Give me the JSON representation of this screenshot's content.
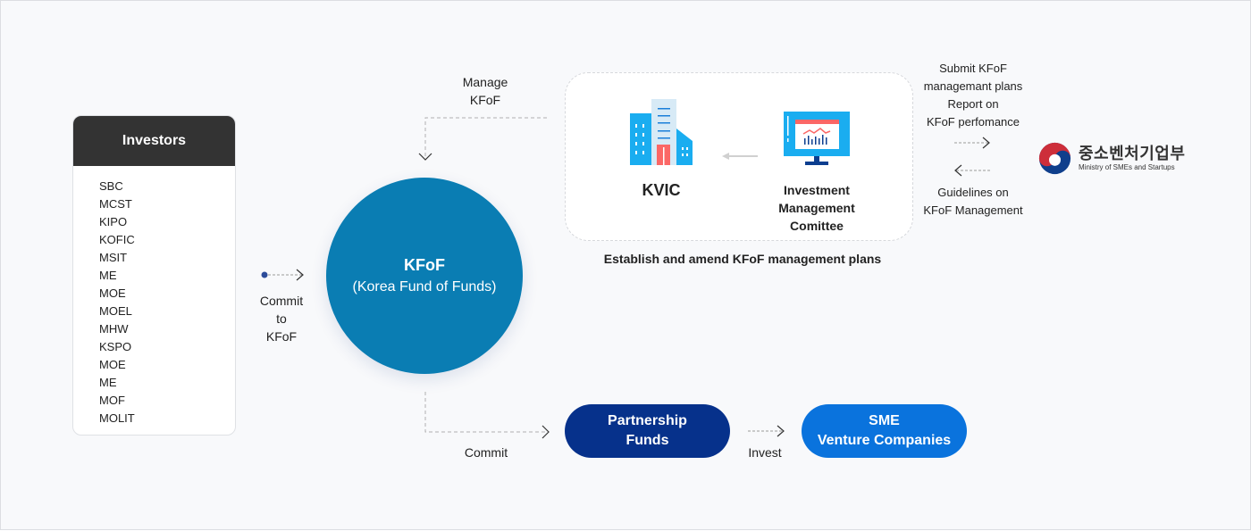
{
  "investors": {
    "title": "Investors",
    "items": [
      "SBC",
      "MCST",
      "KIPO",
      "KOFIC",
      "MSIT",
      "ME",
      "MOE",
      "MOEL",
      "MHW",
      "KSPO",
      "MOE",
      "ME",
      "MOF",
      "MOLIT"
    ]
  },
  "flows": {
    "commit_to_kfof": [
      "Commit",
      "to",
      "KFoF"
    ],
    "manage_kfof": [
      "Manage",
      "KFoF"
    ],
    "commit": "Commit",
    "invest": "Invest",
    "submit_report": [
      "Submit KFoF",
      "managemant plans",
      "Report on",
      "KFoF perfomance"
    ],
    "guidelines": [
      "Guidelines on",
      "KFoF Management"
    ]
  },
  "kfof": {
    "title": "KFoF",
    "subtitle": "(Korea Fund of Funds)"
  },
  "kvic_group": {
    "kvic_label": "KVIC",
    "committee_label": [
      "Investment",
      "Management",
      "Comittee"
    ],
    "caption": "Establish and amend KFoF management plans"
  },
  "partnership_funds": [
    "Partnership",
    "Funds"
  ],
  "sme_venture": [
    "SME",
    "Venture Companies"
  ],
  "ministry_logo": {
    "korean_name": "중소벤처기업부",
    "english_name": "Ministry of SMEs and Startups"
  },
  "colors": {
    "background": "#f8f9fb",
    "investors_header": "#333333",
    "kfof_circle": "#0a7db3",
    "partnership_pill": "#06318b",
    "sme_pill": "#0a73dd",
    "icon_blue": "#1aadf0",
    "icon_red": "#fb6766",
    "icon_navy": "#0c3e8f",
    "logo_red": "#cd2e3a",
    "logo_blue": "#0f3f8c"
  }
}
